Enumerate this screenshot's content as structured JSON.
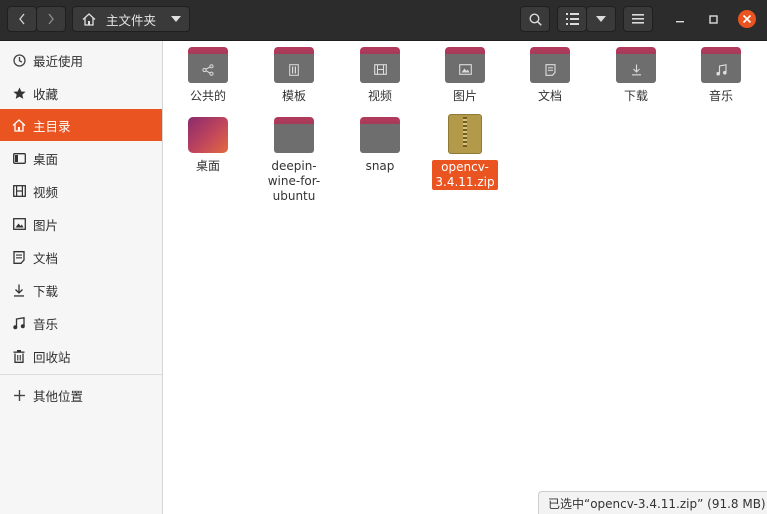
{
  "header": {
    "path_label": "主文件夹",
    "back_icon": "chevron-left-icon",
    "forward_icon": "chevron-right-icon"
  },
  "sidebar": {
    "items": [
      {
        "label": "最近使用",
        "icon": "clock-icon"
      },
      {
        "label": "收藏",
        "icon": "star-icon"
      },
      {
        "label": "主目录",
        "icon": "home-icon",
        "active": true
      },
      {
        "label": "桌面",
        "icon": "desktop-icon"
      },
      {
        "label": "视频",
        "icon": "film-icon"
      },
      {
        "label": "图片",
        "icon": "image-icon"
      },
      {
        "label": "文档",
        "icon": "document-icon"
      },
      {
        "label": "下载",
        "icon": "download-icon"
      },
      {
        "label": "音乐",
        "icon": "music-icon"
      },
      {
        "label": "回收站",
        "icon": "trash-icon"
      }
    ],
    "other_locations": {
      "label": "其他位置",
      "icon": "plus-icon"
    }
  },
  "files": [
    {
      "name": "公共的",
      "type": "folder",
      "icon": "share-icon"
    },
    {
      "name": "模板",
      "type": "folder",
      "icon": "template-icon"
    },
    {
      "name": "视频",
      "type": "folder",
      "icon": "film-icon"
    },
    {
      "name": "图片",
      "type": "folder",
      "icon": "image-icon"
    },
    {
      "name": "文档",
      "type": "folder",
      "icon": "document-icon"
    },
    {
      "name": "下载",
      "type": "folder",
      "icon": "download-icon"
    },
    {
      "name": "音乐",
      "type": "folder",
      "icon": "music-icon"
    },
    {
      "name": "桌面",
      "type": "desktop"
    },
    {
      "name": "deepin-wine-for-ubuntu",
      "lines": [
        "deepin-",
        "wine-for-",
        "ubuntu"
      ],
      "type": "folder"
    },
    {
      "name": "snap",
      "type": "folder"
    },
    {
      "name": "opencv-3.4.11.zip",
      "lines": [
        "opencv-",
        "3.4.11.zip"
      ],
      "type": "zip",
      "selected": true
    }
  ],
  "status": {
    "text": "已选中“opencv-3.4.11.zip” (91.8 MB)"
  },
  "colors": {
    "accent": "#e95420",
    "header": "#2c2c2c",
    "folder_tab": "#b03a5b"
  }
}
